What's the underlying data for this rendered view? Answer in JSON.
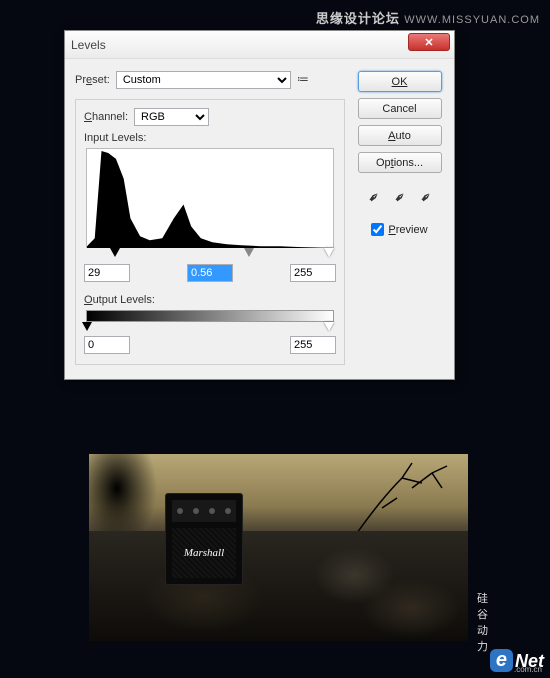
{
  "watermark": {
    "cn": "思缘设计论坛",
    "en": "WWW.MISSYUAN.COM"
  },
  "dialog": {
    "title": "Levels",
    "preset_label": "Preset:",
    "preset_value": "Custom",
    "channel_label": "Channel:",
    "channel_value": "RGB",
    "input_levels_label": "Input Levels:",
    "output_levels_label": "Output Levels:",
    "input_shadow": "29",
    "input_mid": "0.56",
    "input_hi": "255",
    "output_lo": "0",
    "output_hi": "255"
  },
  "buttons": {
    "ok": "OK",
    "cancel": "Cancel",
    "auto": "Auto",
    "options": "Options..."
  },
  "preview": {
    "label": "Preview",
    "checked": true
  },
  "amp": {
    "brand": "Marshall"
  },
  "logo": {
    "e": "e",
    "net": "Net",
    "cn": "硅谷动力",
    "sub": ".com.cn"
  },
  "chart_data": {
    "type": "area",
    "title": "Input Levels Histogram",
    "xlabel": "",
    "ylabel": "",
    "xlim": [
      0,
      255
    ],
    "ylim": [
      0,
      100
    ],
    "x": [
      0,
      8,
      15,
      22,
      30,
      38,
      45,
      55,
      65,
      78,
      90,
      100,
      108,
      118,
      130,
      145,
      160,
      180,
      200,
      225,
      255
    ],
    "values": [
      2,
      10,
      98,
      96,
      90,
      70,
      30,
      12,
      8,
      10,
      30,
      44,
      22,
      10,
      6,
      4,
      3,
      2,
      2,
      1,
      0
    ]
  }
}
